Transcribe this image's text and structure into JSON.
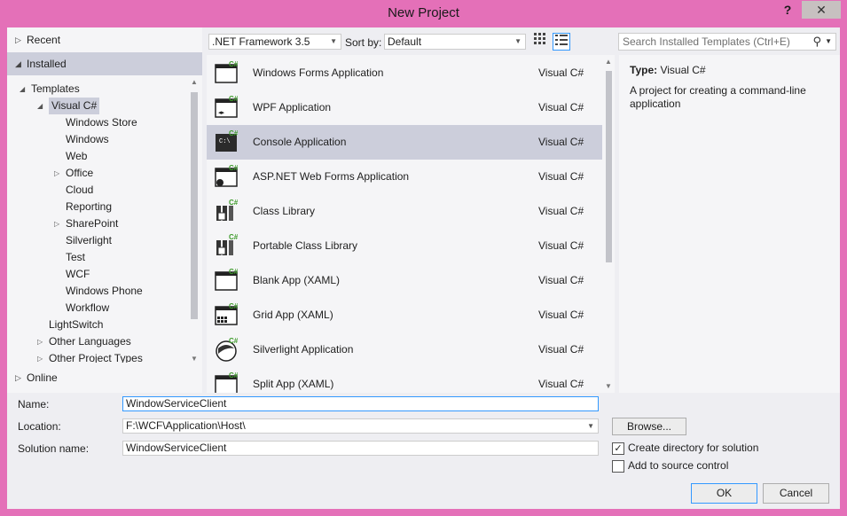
{
  "window": {
    "title": "New Project",
    "help": "?",
    "close": "✕"
  },
  "left_pane": {
    "recent": "Recent",
    "installed": "Installed",
    "online": "Online",
    "tree": [
      {
        "label": "Templates",
        "level": 0,
        "arrow": "◢"
      },
      {
        "label": "Visual C#",
        "level": 1,
        "arrow": "◢",
        "selected": true
      },
      {
        "label": "Windows Store",
        "level": 2
      },
      {
        "label": "Windows",
        "level": 2
      },
      {
        "label": "Web",
        "level": 2
      },
      {
        "label": "Office",
        "level": 2,
        "arrow": "▷"
      },
      {
        "label": "Cloud",
        "level": 2
      },
      {
        "label": "Reporting",
        "level": 2
      },
      {
        "label": "SharePoint",
        "level": 2,
        "arrow": "▷"
      },
      {
        "label": "Silverlight",
        "level": 2
      },
      {
        "label": "Test",
        "level": 2
      },
      {
        "label": "WCF",
        "level": 2
      },
      {
        "label": "Windows Phone",
        "level": 2
      },
      {
        "label": "Workflow",
        "level": 2
      },
      {
        "label": "LightSwitch",
        "level": 1
      },
      {
        "label": "Other Languages",
        "level": 1,
        "arrow": "▷"
      },
      {
        "label": "Other Project Types",
        "level": 1,
        "arrow": "▷"
      }
    ]
  },
  "toolbar": {
    "framework": ".NET Framework 3.5",
    "sort_label": "Sort by:",
    "sort_value": "Default",
    "search_placeholder": "Search Installed Templates (Ctrl+E)"
  },
  "templates": [
    {
      "name": "Windows Forms Application",
      "lang": "Visual C#",
      "icon": "winforms-icon"
    },
    {
      "name": "WPF Application",
      "lang": "Visual C#",
      "icon": "wpf-icon"
    },
    {
      "name": "Console Application",
      "lang": "Visual C#",
      "icon": "console-icon",
      "selected": true
    },
    {
      "name": "ASP.NET Web Forms Application",
      "lang": "Visual C#",
      "icon": "web-forms-icon"
    },
    {
      "name": "Class Library",
      "lang": "Visual C#",
      "icon": "class-library-icon"
    },
    {
      "name": "Portable Class Library",
      "lang": "Visual C#",
      "icon": "portable-library-icon"
    },
    {
      "name": "Blank App (XAML)",
      "lang": "Visual C#",
      "icon": "blank-app-icon"
    },
    {
      "name": "Grid App (XAML)",
      "lang": "Visual C#",
      "icon": "grid-app-icon"
    },
    {
      "name": "Silverlight Application",
      "lang": "Visual C#",
      "icon": "silverlight-icon"
    },
    {
      "name": "Split App (XAML)",
      "lang": "Visual C#",
      "icon": "split-app-icon"
    }
  ],
  "description": {
    "type_label": "Type:",
    "type_value": "Visual C#",
    "text": "A project for creating a command-line application"
  },
  "form": {
    "name_label": "Name:",
    "name_value": "WindowServiceClient",
    "location_label": "Location:",
    "location_value": "F:\\WCF\\Application\\Host\\",
    "solution_label": "Solution name:",
    "solution_value": "WindowServiceClient",
    "browse": "Browse...",
    "create_dir_label": "Create directory for solution",
    "create_dir_checked": true,
    "source_control_label": "Add to source control",
    "source_control_checked": false,
    "ok": "OK",
    "cancel": "Cancel"
  },
  "colors": {
    "frame": "#e470b8",
    "selection": "#cccedb",
    "focus": "#3399ff",
    "csharp_badge": "#3c9a29"
  }
}
